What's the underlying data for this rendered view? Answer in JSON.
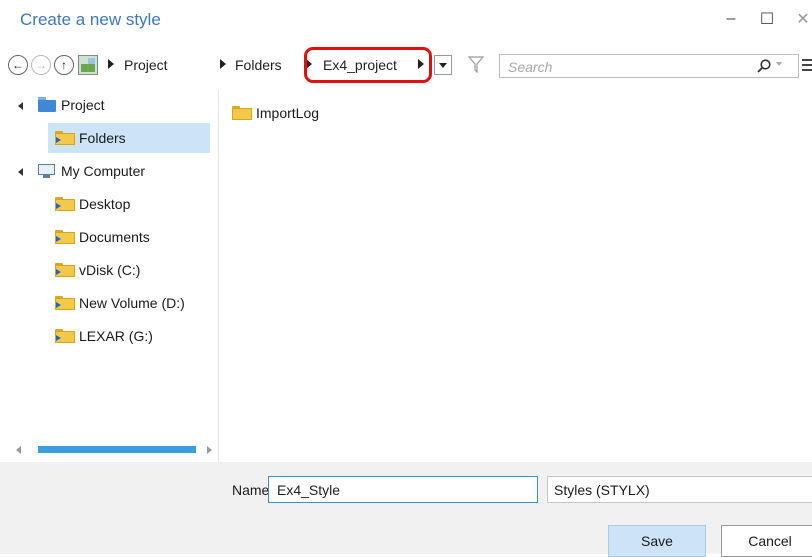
{
  "window": {
    "title": "Create a new style",
    "minimize_glyph": "–",
    "maximize_glyph": "☐",
    "close_glyph": "✕"
  },
  "navigation": {
    "back_icon": "back-arrow-icon",
    "forward_icon": "forward-arrow-icon",
    "up_icon": "up-arrow-icon",
    "breadcrumbs": [
      "Project",
      "Folders",
      "Ex4_project"
    ],
    "highlight_color": "#e01010"
  },
  "search": {
    "placeholder": "Search"
  },
  "tree": {
    "items": [
      {
        "label": "Project",
        "icon": "project-icon",
        "expanded": true
      },
      {
        "label": "Folders",
        "icon": "folder-link-icon",
        "selected": true
      },
      {
        "label": "My Computer",
        "icon": "computer-icon",
        "expanded": true
      },
      {
        "label": "Desktop",
        "icon": "folder-icon"
      },
      {
        "label": "Documents",
        "icon": "folder-icon"
      },
      {
        "label": "vDisk (C:)",
        "icon": "folder-icon"
      },
      {
        "label": "New Volume (D:)",
        "icon": "folder-icon"
      },
      {
        "label": "LEXAR (G:)",
        "icon": "folder-icon"
      }
    ]
  },
  "content": {
    "items": [
      {
        "label": "ImportLog",
        "icon": "folder-icon"
      }
    ]
  },
  "footer": {
    "name_label": "Name",
    "name_value": "Ex4_Style",
    "type_value": "Styles (STYLX)",
    "save_label": "Save",
    "cancel_label": "Cancel"
  },
  "colors": {
    "accent": "#3a78c4",
    "selection": "#cce4f7",
    "scroll_thumb": "#3b9ddd"
  }
}
